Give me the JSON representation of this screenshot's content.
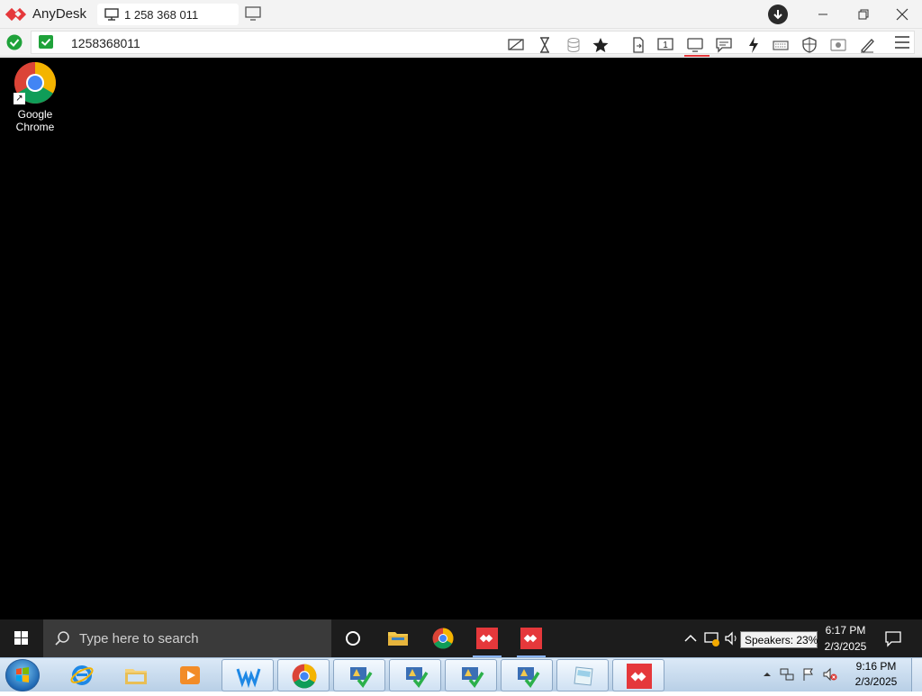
{
  "titlebar": {
    "app_name": "AnyDesk",
    "session_tab_label": "1 258 368 011",
    "brand_color": "#e5383b"
  },
  "addressbar": {
    "address_value": "1258368011",
    "toolbar_icons": [
      "hide-screen-icon",
      "timer-icon",
      "database-icon",
      "star-icon",
      "file-transfer-icon",
      "display-1-icon",
      "monitor-icon",
      "chat-icon",
      "lightning-icon",
      "keyboard-icon",
      "shield-icon",
      "record-icon",
      "pen-icon"
    ]
  },
  "remote_desktop": {
    "icons": [
      {
        "label_line1": "Google",
        "label_line2": "Chrome"
      }
    ],
    "taskbar": {
      "search_placeholder": "Type here to search",
      "tooltip": "Speakers: 23%",
      "time": "6:17 PM",
      "date": "2/3/2025"
    }
  },
  "local_taskbar": {
    "time": "9:16 PM",
    "date": "2/3/2025"
  }
}
